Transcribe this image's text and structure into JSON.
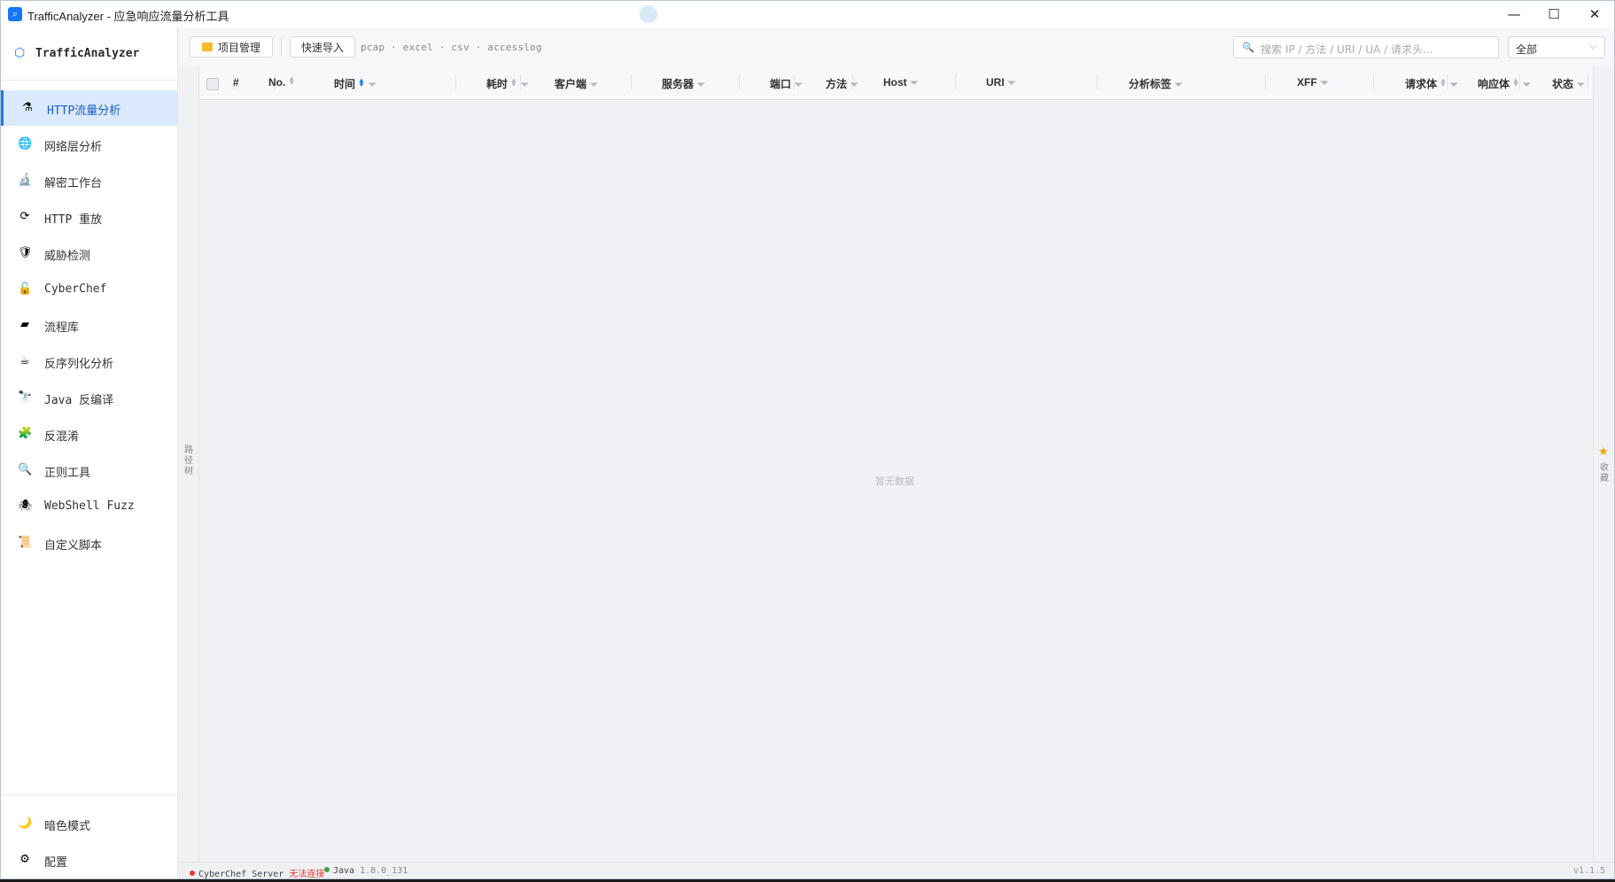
{
  "window": {
    "title": "TrafficAnalyzer - 应急响应流量分析工具",
    "controls": {
      "minimize": "—",
      "maximize": "☐",
      "close": "✕"
    }
  },
  "sidebar": {
    "brand": "TrafficAnalyzer",
    "items": [
      {
        "label": "HTTP流量分析",
        "icon": "⚗",
        "icon_name": "http-analysis-icon",
        "active": true
      },
      {
        "label": "网络层分析",
        "icon": "🌐",
        "icon_name": "globe-icon"
      },
      {
        "label": "解密工作台",
        "icon": "🔬",
        "icon_name": "microscope-icon"
      },
      {
        "label": "HTTP 重放",
        "icon": "⟳",
        "icon_name": "replay-icon"
      },
      {
        "label": "威胁检测",
        "icon": "🛡",
        "icon_name": "shield-icon"
      },
      {
        "label": "CyberChef",
        "icon": "🔓",
        "icon_name": "unlock-icon"
      },
      {
        "label": "流程库",
        "icon": "▰",
        "icon_name": "library-icon"
      },
      {
        "label": "反序列化分析",
        "icon": "☕",
        "icon_name": "coffee-icon"
      },
      {
        "label": "Java 反编译",
        "icon": "🔭",
        "icon_name": "telescope-icon"
      },
      {
        "label": "反混淆",
        "icon": "🧩",
        "icon_name": "puzzle-icon"
      },
      {
        "label": "正则工具",
        "icon": "🔍",
        "icon_name": "magnifier-icon"
      },
      {
        "label": "WebShell Fuzz",
        "icon": "🕷",
        "icon_name": "spider-icon"
      },
      {
        "label": "自定义脚本",
        "icon": "📜",
        "icon_name": "scroll-icon"
      }
    ],
    "bottom": [
      {
        "label": "暗色模式",
        "icon": "🌙",
        "icon_name": "moon-icon"
      },
      {
        "label": "配置",
        "icon": "⚙",
        "icon_name": "gear-icon"
      }
    ]
  },
  "toolbar": {
    "project_label": "项目管理",
    "import_label": "快速导入",
    "formats": "pcap · excel · csv · accesslog",
    "search_placeholder": "搜索 IP / 方法 / URI / UA / 请求头...",
    "filter_value": "全部"
  },
  "side_panels": {
    "left": "路径树",
    "right": "收藏"
  },
  "table": {
    "columns": [
      {
        "label": "#",
        "sort": false,
        "filter": false
      },
      {
        "label": "No.",
        "sort": true,
        "filter": false
      },
      {
        "label": "时间",
        "sort": true,
        "sort_active": "asc",
        "filter": true
      },
      {
        "label": "耗时",
        "sort": true,
        "filter": true
      },
      {
        "label": "客户端",
        "sort": false,
        "filter": true
      },
      {
        "label": "服务器",
        "sort": false,
        "filter": true
      },
      {
        "label": "端口",
        "sort": false,
        "filter": true
      },
      {
        "label": "方法",
        "sort": false,
        "filter": true
      },
      {
        "label": "Host",
        "sort": false,
        "filter": true
      },
      {
        "label": "URI",
        "sort": false,
        "filter": true
      },
      {
        "label": "分析标签",
        "sort": false,
        "filter": true
      },
      {
        "label": "XFF",
        "sort": false,
        "filter": true
      },
      {
        "label": "请求体",
        "sort": true,
        "filter": true
      },
      {
        "label": "响应体",
        "sort": true,
        "filter": true
      },
      {
        "label": "状态",
        "sort": false,
        "filter": true
      }
    ],
    "rows": [],
    "empty_text": "暂无数据"
  },
  "status": {
    "cyberchef_label": "CyberChef Server",
    "cyberchef_state": "无法连接",
    "cyberchef_color": "#e53935",
    "java_label": "Java",
    "java_version": "1.8.0_131",
    "java_color": "#43a047",
    "app_version": "v1.1.5"
  }
}
